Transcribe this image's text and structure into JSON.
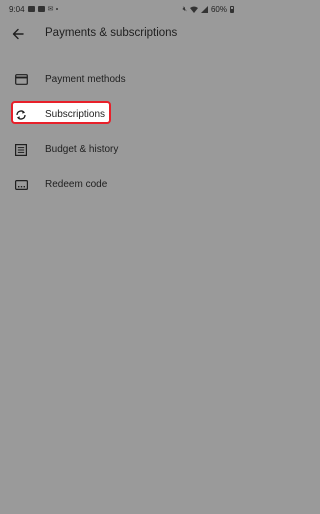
{
  "status_bar": {
    "time": "9:04",
    "battery_text": "60%",
    "battery_level": 0.6,
    "left_icons": [
      "photo-icon",
      "contact-card-icon",
      "gmail-icon",
      "notification-dot"
    ],
    "right_icons": [
      "mute-icon",
      "wifi-icon",
      "signal-icon",
      "battery-icon"
    ]
  },
  "header": {
    "back_icon": "arrow-left-icon",
    "title": "Payments & subscriptions"
  },
  "menu": {
    "items": [
      {
        "label": "Payment methods",
        "icon": "credit-card-icon",
        "highlighted": false
      },
      {
        "label": "Subscriptions",
        "icon": "sync-icon",
        "highlighted": true
      },
      {
        "label": "Budget & history",
        "icon": "list-icon",
        "highlighted": false
      },
      {
        "label": "Redeem code",
        "icon": "redeem-code-icon",
        "highlighted": false
      }
    ]
  },
  "colors": {
    "background": "#9a9a9a",
    "highlight_border": "#e8202a",
    "highlight_fill": "#ffffff",
    "text": "#1f1f1f"
  }
}
